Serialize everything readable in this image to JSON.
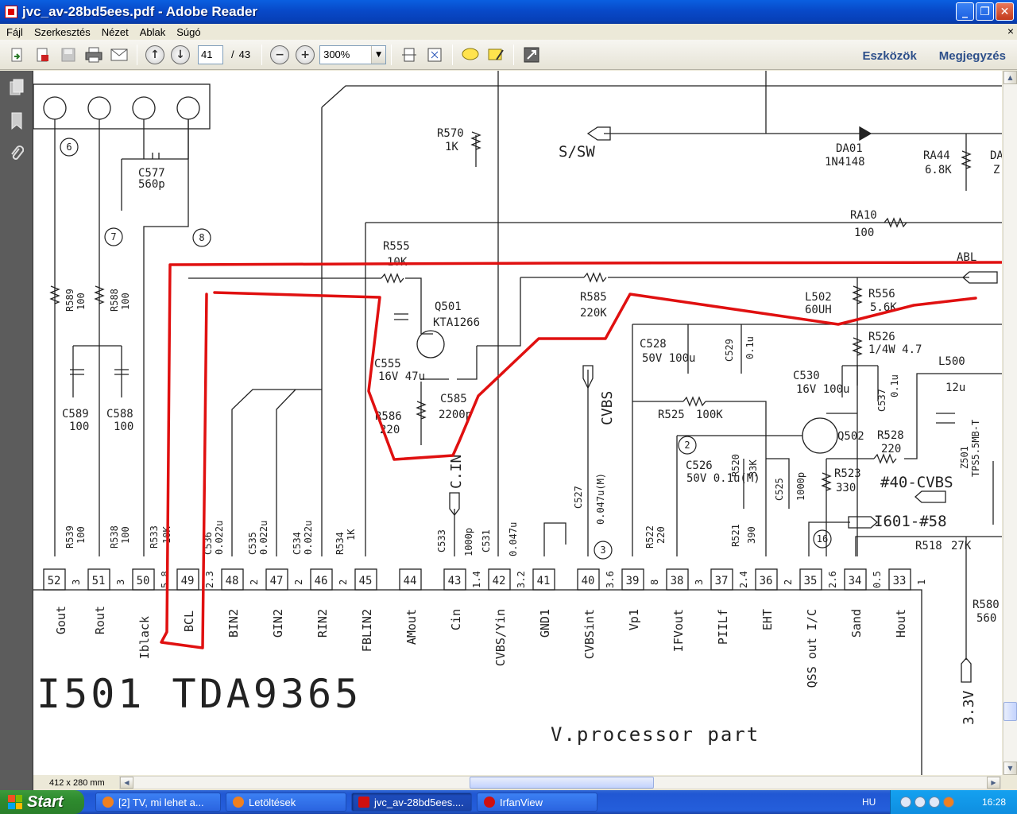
{
  "window": {
    "title": "jvc_av-28bd5ees.pdf - Adobe Reader",
    "buttons": {
      "minimize": "_",
      "maximize": "❐",
      "close": "✕"
    }
  },
  "menu": {
    "items": [
      "Fájl",
      "Szerkesztés",
      "Nézet",
      "Ablak",
      "Súgó"
    ],
    "close_glyph": "×"
  },
  "toolbar": {
    "page_current": "41",
    "page_separator": "/",
    "page_total": "43",
    "zoom": "300%",
    "tools_label": "Eszközök",
    "comment_label": "Megjegyzés"
  },
  "status": {
    "page_size": "412 x 280 mm"
  },
  "schematic": {
    "top_labels": [
      "S/SW",
      "R570",
      "1K",
      "DA01",
      "1N4148",
      "RA44",
      "6.8K",
      "DA",
      "Z",
      "RA10",
      "100",
      "ABL"
    ],
    "connector_circles": [
      "6",
      "7",
      "8",
      "2",
      "3",
      "16"
    ],
    "components": [
      {
        "ref": "C577",
        "value": "560p"
      },
      {
        "ref": "R555",
        "value": "10K"
      },
      {
        "ref": "Q501",
        "value": "KTA1266"
      },
      {
        "ref": "R585",
        "value": "220K"
      },
      {
        "ref": "L502",
        "value": "60UH"
      },
      {
        "ref": "R556",
        "value": "5.6K"
      },
      {
        "ref": "R526",
        "value": "1/4W 4.7"
      },
      {
        "ref": "C528",
        "value": "50V 100u"
      },
      {
        "ref": "C529",
        "value": "0.1u"
      },
      {
        "ref": "C530",
        "value": "16V 100u"
      },
      {
        "ref": "C537",
        "value": "0.1u"
      },
      {
        "ref": "L500",
        "value": "12u"
      },
      {
        "ref": "C555",
        "value": "16V 47u"
      },
      {
        "ref": "C585",
        "value": "2200p"
      },
      {
        "ref": "R586",
        "value": "220"
      },
      {
        "ref": "R525",
        "value": "100K"
      },
      {
        "ref": "Q502",
        "value": ""
      },
      {
        "ref": "R528",
        "value": "220"
      },
      {
        "ref": "Z501",
        "value": "TPS5.5MB-T"
      },
      {
        "ref": "C526",
        "value": "50V 0.1u(M)"
      },
      {
        "ref": "R520",
        "value": "33K"
      },
      {
        "ref": "C525",
        "value": "1000p"
      },
      {
        "ref": "R523",
        "value": "330"
      },
      {
        "ref": "R589",
        "value": "100"
      },
      {
        "ref": "R588",
        "value": "100"
      },
      {
        "ref": "C589",
        "value": "100"
      },
      {
        "ref": "C588",
        "value": "100"
      },
      {
        "ref": "C527",
        "value": "0.047u(M)"
      },
      {
        "ref": "R518",
        "value": "27K"
      },
      {
        "ref": "R580",
        "value": "560"
      }
    ],
    "net_labels": [
      "CVBS",
      "#40-CVBS",
      "I601-#58",
      "C.IN",
      "3.3V"
    ],
    "bottom_parts": [
      {
        "ref": "R539",
        "value": "100"
      },
      {
        "ref": "R538",
        "value": "100"
      },
      {
        "ref": "R533",
        "value": "10K"
      },
      {
        "ref": "C536",
        "value": "0.022u"
      },
      {
        "ref": "C535",
        "value": "0.022u"
      },
      {
        "ref": "C534",
        "value": "0.022u"
      },
      {
        "ref": "R534",
        "value": "1K"
      },
      {
        "ref": "C533",
        "value": "1000p"
      },
      {
        "ref": "C531",
        "value": "0.047u"
      },
      {
        "ref": "R522",
        "value": "220"
      },
      {
        "ref": "R521",
        "value": "390"
      }
    ],
    "pins": [
      {
        "num": "52",
        "name": "Gout",
        "v": "3"
      },
      {
        "num": "51",
        "name": "Rout",
        "v": "3"
      },
      {
        "num": "50",
        "name": "Iblack",
        "v": "5.8"
      },
      {
        "num": "49",
        "name": "BCL",
        "v": "2.3"
      },
      {
        "num": "48",
        "name": "BIN2",
        "v": "2"
      },
      {
        "num": "47",
        "name": "GIN2",
        "v": "2"
      },
      {
        "num": "46",
        "name": "RIN2",
        "v": "2"
      },
      {
        "num": "45",
        "name": "FBLIN2",
        "v": ""
      },
      {
        "num": "44",
        "name": "AMout",
        "v": ""
      },
      {
        "num": "43",
        "name": "Cin",
        "v": "1.4"
      },
      {
        "num": "42",
        "name": "CVBS/Yin",
        "v": "3.2"
      },
      {
        "num": "41",
        "name": "GND1",
        "v": ""
      },
      {
        "num": "40",
        "name": "CVBSint",
        "v": "3.6"
      },
      {
        "num": "39",
        "name": "Vp1",
        "v": "8"
      },
      {
        "num": "38",
        "name": "IFVout",
        "v": "3"
      },
      {
        "num": "37",
        "name": "PIILf",
        "v": "2.4"
      },
      {
        "num": "36",
        "name": "EHT",
        "v": "2"
      },
      {
        "num": "35",
        "name": "QSS out I/C",
        "v": "2.6"
      },
      {
        "num": "34",
        "name": "Sand",
        "v": "0.5"
      },
      {
        "num": "33",
        "name": "Hout",
        "v": "1"
      }
    ],
    "ic_name": "I501 TDA9365",
    "section_name": "V.processor part",
    "highlight_color": "#e01010"
  },
  "taskbar": {
    "start_label": "Start",
    "tasks": [
      {
        "label": "[2] TV, mi lehet a...",
        "color": "#f08020"
      },
      {
        "label": "Letöltések",
        "color": "#f08020"
      },
      {
        "label": "jvc_av-28bd5ees....",
        "color": "#d01010"
      },
      {
        "label": "IrfanView",
        "color": "#d01010"
      }
    ],
    "lang": "HU",
    "clock": "16:28"
  }
}
